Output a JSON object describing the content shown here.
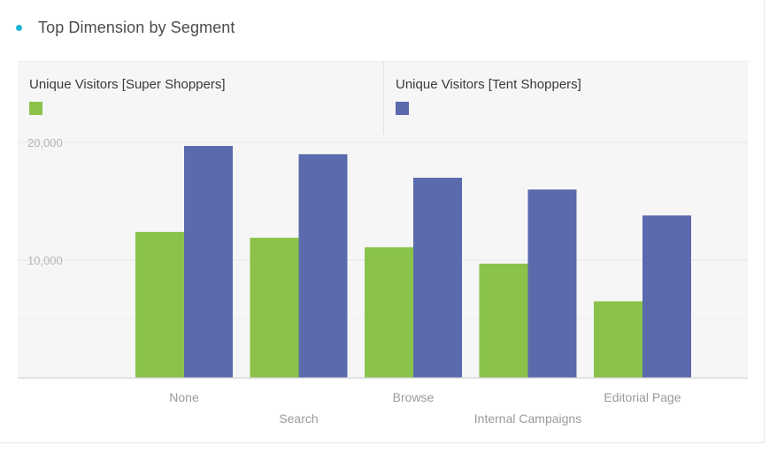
{
  "widget": {
    "title": "Top Dimension by Segment"
  },
  "colors": {
    "title_dot": "#1fb4d6",
    "series_1": "#8bc34a",
    "series_2": "#5a6aad",
    "grid": "#e6e6e6",
    "tick_text": "#b5b5b5",
    "category_text": "#9a9a9a"
  },
  "chart_data": {
    "type": "bar",
    "title": "Top Dimension by Segment",
    "xlabel": "",
    "ylabel": "",
    "categories": [
      "None",
      "Search",
      "Browse",
      "Internal Campaigns",
      "Editorial Page"
    ],
    "series": [
      {
        "name": "Unique Visitors [Super Shoppers]",
        "color": "#8bc34a",
        "values": [
          12400,
          11900,
          11100,
          9700,
          6500
        ]
      },
      {
        "name": "Unique Visitors [Tent Shoppers]",
        "color": "#5a6aad",
        "values": [
          19700,
          19000,
          17000,
          16000,
          13800
        ]
      }
    ],
    "yticks": [
      "20,000",
      "10,000"
    ],
    "ytick_values": [
      20000,
      10000
    ],
    "ylim": [
      0,
      20000
    ],
    "grid": true,
    "legend_position": "top"
  }
}
